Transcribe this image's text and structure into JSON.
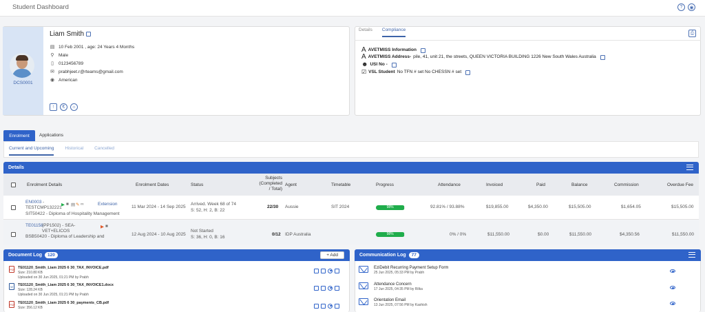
{
  "app": {
    "title": "Student Dashboard"
  },
  "profile": {
    "student_id": "DCS0001",
    "name": "Liam Smith",
    "dob": "10 Feb 2001 , age: 24 Years 4 Months",
    "gender": "Male",
    "phone": "0123456789",
    "email": "prabhjeet.r@rteams@gmail.com",
    "nationality": "American"
  },
  "compliance": {
    "tabs": [
      "Details",
      "Compliance"
    ],
    "avetmiss_info_label": "AVETMISS Information",
    "avetmiss_address_label": "AVETMISS Address-",
    "avetmiss_address_value": "pile, 41, unit 21, the streets, QUEEN VICTORIA BUILDING 1226 New South Wales Australia",
    "usi_label": "USI No -",
    "vsl_label": "VSL Student",
    "vsl_value": "No TFN # set No CHESSN # set"
  },
  "main_tabs": [
    "Enrolment",
    "Applications"
  ],
  "sub_tabs": [
    "Current and Upcoming",
    "Historical",
    "Cancelled"
  ],
  "details": {
    "title": "Details",
    "columns": [
      "Enrolment Details",
      "Enrolment Dates",
      "Status",
      "Subjects (Completed / Total)",
      "Agent",
      "Timetable",
      "Progress",
      "Attendance",
      "Invoiced",
      "Paid",
      "Balance",
      "Commission",
      "Overdue Fee"
    ],
    "col_subjects_lines": [
      "Subjects",
      "(Completed",
      "/ Total)"
    ],
    "rows": [
      {
        "code": "EN0003",
        "sep": "-",
        "sub": "TESTCMP132221",
        "course": "SIT50422 - Diploma of Hospitality Management",
        "tag": "Extension",
        "dates": "11 Mar 2024 - 14 Sep 2025",
        "status1": "Arrived. Week 68 of 74",
        "status2": "S: 52, H: 2, B: 22",
        "subjects": "22/30",
        "agent": "Aussie",
        "timetable": "SIT 2024",
        "progress": 0.98,
        "progress_label": "98%",
        "attendance": "92.81% / 93.88%",
        "invoiced": "$19,855.00",
        "paid": "$4,350.00",
        "balance": "$15,505.00",
        "commission": "$1,654.05",
        "overdue": "$15,505.00"
      },
      {
        "code": "TE01158",
        "code_extra": "(PP1502) - SEA-VET+ELICOS",
        "course": "BSB50420 - Diploma of Leadership and",
        "dates": "12 Aug 2024 - 10 Aug 2025",
        "status1": "Not Started",
        "status2": "S: 36, H: 0, B: 16",
        "subjects": "0/12",
        "agent": "IDP Australia",
        "timetable": "",
        "progress": 0.98,
        "progress_label": "98%",
        "attendance": "0% / 0%",
        "invoiced": "$11,550.00",
        "paid": "$0.00",
        "balance": "$11,550.00",
        "commission": "$4,350.56",
        "overdue": "$11,550.00"
      }
    ]
  },
  "document_log": {
    "title": "Document Log",
    "count": "120",
    "add_label": "+ Add",
    "items": [
      {
        "type": "pdf",
        "name": "TE01120_Smith_Liam 2025 6 30_TAX_INVOICE.pdf",
        "size": "Size: 210.80 KB",
        "uploaded": "Uploaded on 30 Jun 2025, 01:21 PM by Prabh"
      },
      {
        "type": "doc",
        "name": "TE01120_Smith_Liam 2025 6 30_TAX_INVOICE1.docx",
        "size": "Size: 128.24 KB",
        "uploaded": "Uploaded on 30 Jun 2025, 01:21 PM by Prabh"
      },
      {
        "type": "pdf",
        "name": "TE01120_Smith_Liam 2025 6 30_payments_CB.pdf",
        "size": "Size: 356.12 KB",
        "uploaded": ""
      }
    ]
  },
  "communication_log": {
    "title": "Communication Log",
    "count": "77",
    "items": [
      {
        "subject": "EziDebit Recurring Payment Setup Form",
        "meta": "25 Jun 2025, 05:33 PM by Prabh"
      },
      {
        "subject": "Attendance Concern",
        "meta": "17 Jun 2025, 04:35 PM by Rilka"
      },
      {
        "subject": "Orientation Email",
        "meta": "13 Jun 2025, 07:56 PM by Kashish"
      }
    ]
  },
  "colors": {
    "primary": "#2f63c9",
    "progress": "#1fad4b"
  }
}
